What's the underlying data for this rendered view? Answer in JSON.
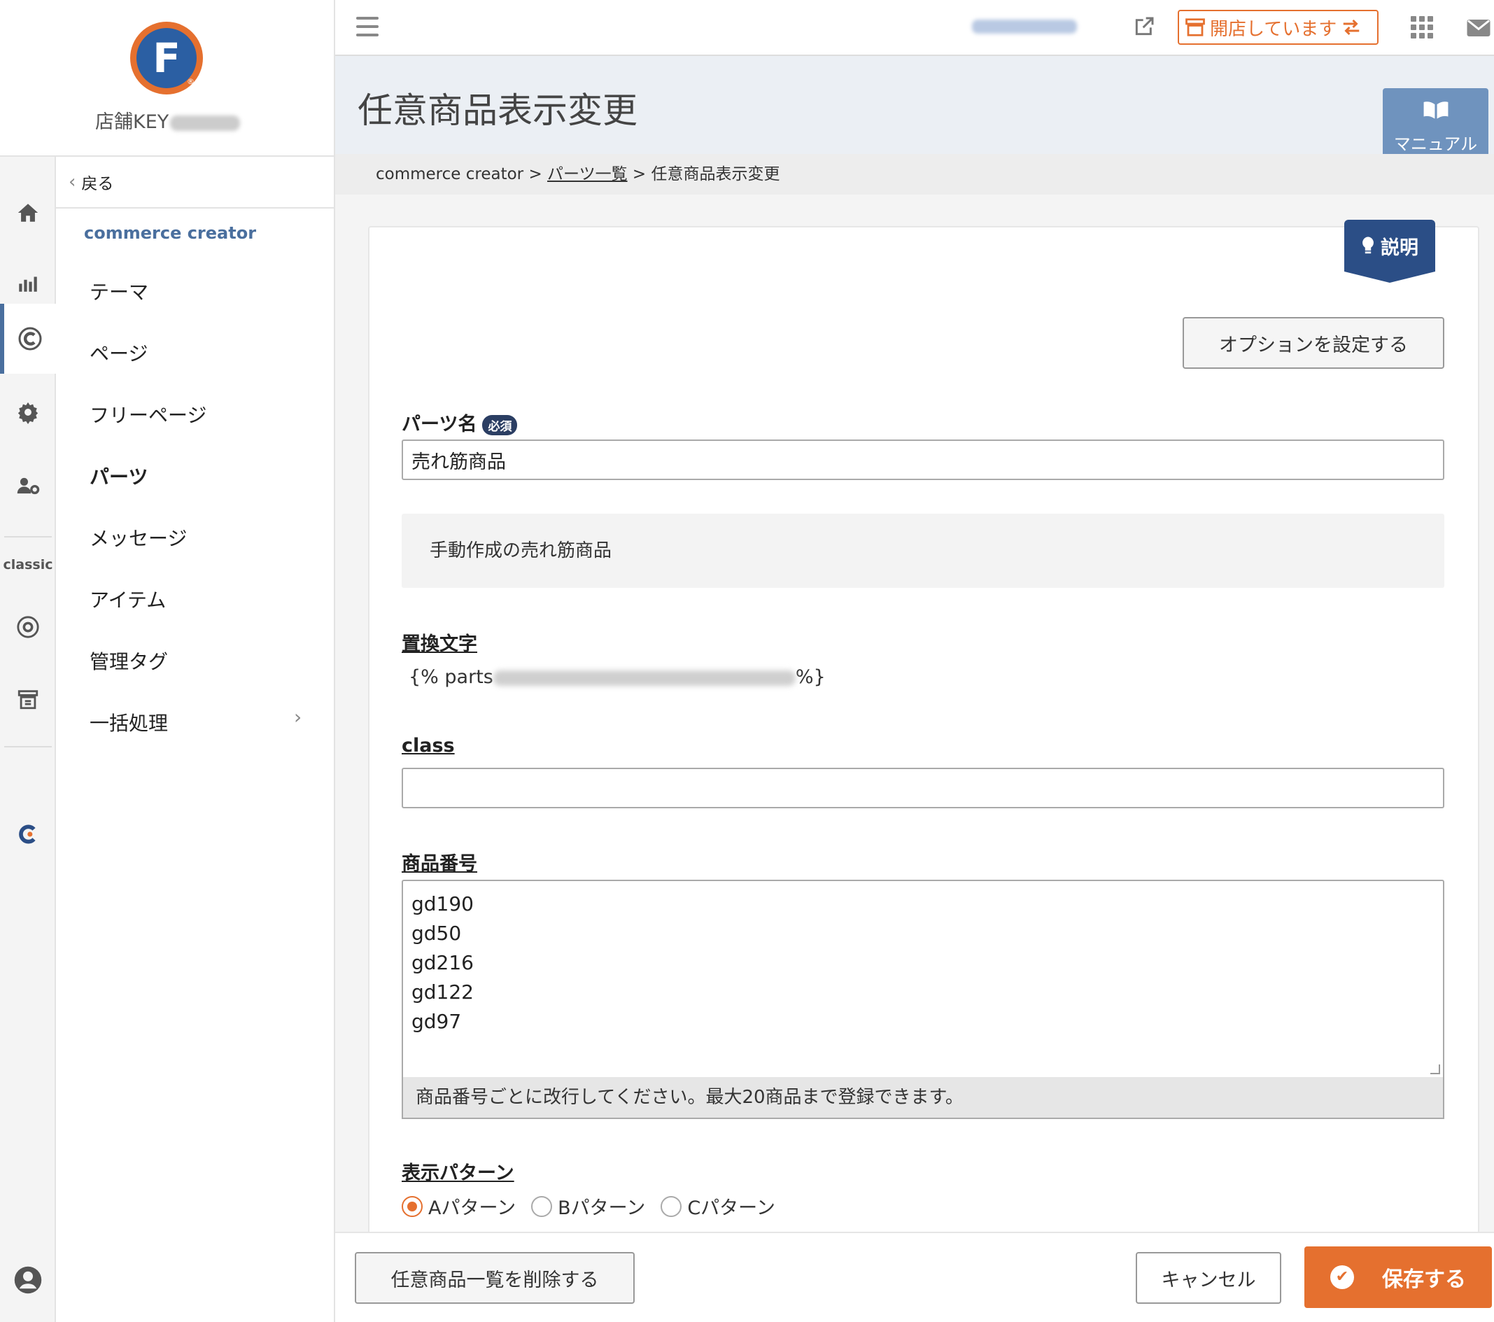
{
  "brand": {
    "logo_letter": "F",
    "logo_reg": "®",
    "store_key_label": "店舗KEY",
    "store_key_value_hidden": true
  },
  "rail": {
    "classic_label": "classic"
  },
  "subnav": {
    "back_label": "戻る",
    "section_title": "commerce creator",
    "items": [
      {
        "label": "テーマ"
      },
      {
        "label": "ページ"
      },
      {
        "label": "フリーページ"
      },
      {
        "label": "パーツ",
        "active": true
      },
      {
        "label": "メッセージ"
      },
      {
        "label": "アイテム"
      },
      {
        "label": "管理タグ"
      },
      {
        "label": "一括処理",
        "has_submenu": true
      }
    ]
  },
  "topbar": {
    "open_status": "開店しています"
  },
  "page": {
    "title": "任意商品表示変更",
    "manual_label": "マニュアル",
    "breadcrumb": {
      "root": "commerce creator",
      "sep": ">",
      "parent": "パーツ一覧",
      "current": "任意商品表示変更"
    }
  },
  "form": {
    "help_label": "説明",
    "options_button": "オプションを設定する",
    "parts_name_label": "パーツ名",
    "required_badge": "必須",
    "parts_name_value": "売れ筋商品",
    "description": "手動作成の売れ筋商品",
    "replace_label": "置換文字",
    "replace_prefix": "{% parts",
    "replace_suffix": "%}",
    "class_label": "class",
    "class_value": "",
    "product_no_label": "商品番号",
    "product_numbers": [
      "gd190",
      "gd50",
      "gd216",
      "gd122",
      "gd97"
    ],
    "product_hint": "商品番号ごとに改行してください。最大20商品まで登録できます。",
    "pattern_label": "表示パターン",
    "patterns": [
      {
        "label": "Aパターン",
        "selected": true
      },
      {
        "label": "Bパターン",
        "selected": false
      },
      {
        "label": "Cパターン",
        "selected": false
      }
    ]
  },
  "footer": {
    "delete_button": "任意商品一覧を削除する",
    "cancel_button": "キャンセル",
    "save_button": "保存する"
  },
  "colors": {
    "accent": "#e5702f",
    "brand_blue": "#2b5fa3",
    "nav_blue": "#4a6f9e",
    "manual_blue": "#6f93be",
    "help_navy": "#2b4e86"
  }
}
